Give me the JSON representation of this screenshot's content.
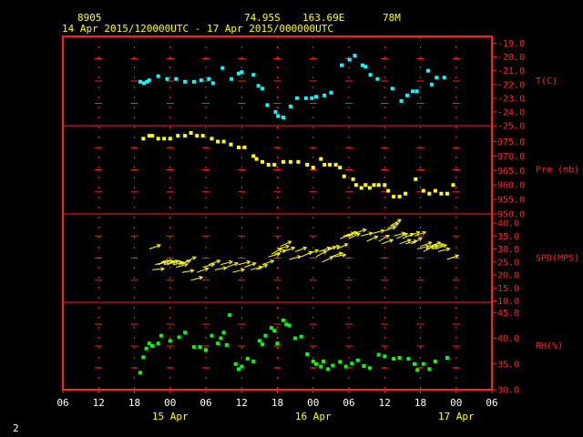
{
  "header": {
    "station_id": "8905",
    "lat": "74.95S",
    "lon": "163.69E",
    "elevation": "78M",
    "period": "14 Apr 2015/120000UTC - 17 Apr 2015/000000UTC"
  },
  "page_number": "2",
  "colors": {
    "frame": "#ff2020",
    "temperature": "#00ffff",
    "pressure": "#ffff00",
    "wind": "#ffff00",
    "humidity": "#00ff00",
    "header_text": "#ffff00",
    "axis_text": "#ffffff"
  },
  "chart_data": {
    "type": "scatter",
    "x_unit": "hours since 14 Apr 2015 06UTC",
    "x_range": [
      0,
      72
    ],
    "x_tick_labels": [
      "06",
      "12",
      "18",
      "00",
      "06",
      "12",
      "18",
      "00",
      "06",
      "12",
      "18",
      "00",
      "06"
    ],
    "date_labels": [
      {
        "x": 18,
        "text": "15 Apr"
      },
      {
        "x": 42,
        "text": "16 Apr"
      },
      {
        "x": 66,
        "text": "17 Apr"
      }
    ],
    "panels": [
      {
        "key": "temperature",
        "label": "T(C)",
        "ylim": [
          -25.0,
          -18.5
        ],
        "ticks": [
          "-19.0",
          "-20.0",
          "-21.0",
          "-22.0",
          "-23.0",
          "-24.0",
          "-25.0"
        ],
        "x": [
          13,
          13.6,
          14.1,
          14.5,
          16,
          17.5,
          19,
          20.5,
          22,
          23.2,
          24.5,
          25.2,
          26.8,
          28.3,
          29.5,
          30,
          32,
          32.8,
          33.5,
          34.3,
          35.7,
          36.1,
          37,
          38.2,
          39.3,
          40.8,
          41.8,
          42.5,
          43.9,
          45,
          46.8,
          48.1,
          49,
          50.3,
          50.8,
          51.6,
          52.8,
          55.3,
          56.8,
          57.8,
          58.7,
          59.4,
          61.3,
          61.9,
          62.7,
          64
        ],
        "values": [
          -21.8,
          -21.9,
          -21.8,
          -21.7,
          -21.4,
          -21.6,
          -21.6,
          -21.8,
          -21.8,
          -21.7,
          -21.6,
          -21.9,
          -20.8,
          -21.6,
          -21.2,
          -21.1,
          -21.3,
          -22.1,
          -22.3,
          -23.5,
          -24.0,
          -24.3,
          -24.4,
          -23.6,
          -23.0,
          -23.0,
          -23.0,
          -22.9,
          -22.8,
          -22.6,
          -20.6,
          -20.2,
          -19.9,
          -20.6,
          -20.7,
          -21.3,
          -21.6,
          -22.3,
          -23.2,
          -22.8,
          -22.5,
          -22.5,
          -21.0,
          -22.0,
          -21.5,
          -21.5
        ]
      },
      {
        "key": "pressure",
        "label": "Pre (mb)",
        "ylim": [
          950.0,
          980.5
        ],
        "ticks": [
          "975.0",
          "970.0",
          "965.0",
          "960.0",
          "955.0",
          "950.0"
        ],
        "x": [
          13.5,
          14.5,
          15,
          16,
          17,
          18,
          19.3,
          20.5,
          21.5,
          22.5,
          23.5,
          25,
          26,
          27,
          28.2,
          29.5,
          30.5,
          32,
          32.5,
          33.5,
          34.5,
          35.5,
          37,
          38.2,
          39.5,
          41,
          42,
          43.3,
          43.9,
          44.8,
          45.8,
          46.5,
          47.2,
          48.7,
          49.2,
          50.1,
          50.8,
          51.5,
          52.2,
          53,
          54,
          54.6,
          55.5,
          56.5,
          57.5,
          59.2,
          60.5,
          61.5,
          62.5,
          63.5,
          64.5,
          65.5
        ],
        "values": [
          976,
          977,
          977,
          976,
          976,
          976,
          977,
          977,
          978,
          977,
          977,
          976,
          975,
          975,
          974,
          973,
          973,
          970,
          969,
          968,
          967,
          967,
          968,
          968,
          968,
          967,
          966,
          969,
          967,
          967,
          967,
          966,
          963,
          962,
          960,
          959,
          960,
          959,
          960,
          960,
          960,
          958,
          956,
          956,
          957,
          962,
          958,
          957,
          958,
          957,
          957,
          960
        ]
      },
      {
        "key": "wind",
        "label": "SPD(MPS)",
        "ylim": [
          9.5,
          43.5
        ],
        "ticks": [
          "40.0",
          "35.0",
          "30.0",
          "25.0",
          "20.0",
          "15.0",
          "10.0"
        ],
        "x": [
          14.5,
          15.0,
          15.5,
          16,
          16.5,
          17,
          17.5,
          18,
          18.5,
          19,
          19.5,
          20,
          20.5,
          21.5,
          22.5,
          23.5,
          24.5,
          25.5,
          26.5,
          27.5,
          28.5,
          29.5,
          30.5,
          31.5,
          32.5,
          33.5,
          34.5,
          35,
          35.5,
          36,
          36.5,
          37,
          38,
          39,
          40,
          41,
          42.5,
          43,
          43.5,
          44,
          44.5,
          45,
          45.5,
          46,
          46.5,
          47,
          47.5,
          48,
          49,
          50,
          51,
          52,
          53,
          53.5,
          54,
          54.5,
          55,
          55.5,
          56,
          56.5,
          57,
          57.5,
          58,
          58.5,
          59,
          59.5,
          60,
          60.5,
          61,
          61.5,
          62,
          62.5,
          63,
          64.5
        ],
        "values": [
          30,
          22,
          24,
          24,
          25,
          24,
          24,
          25,
          24,
          23,
          24,
          21,
          25,
          18,
          21,
          23,
          24,
          22,
          24,
          23,
          21,
          24,
          23,
          22,
          22,
          24,
          27,
          28,
          28,
          30,
          31,
          29,
          26,
          29,
          27,
          28,
          27,
          29,
          25,
          29,
          30,
          27,
          27,
          30,
          34,
          35,
          35,
          34,
          36,
          35,
          33,
          36,
          33,
          32,
          37,
          38,
          39,
          35,
          34,
          32,
          34,
          32,
          35,
          32,
          35,
          30,
          31,
          29,
          30,
          31,
          30,
          30,
          29,
          26
        ],
        "dir_deg": [
          20,
          5,
          15,
          20,
          5,
          15,
          20,
          0,
          10,
          15,
          20,
          10,
          25,
          15,
          20,
          15,
          20,
          10,
          15,
          20,
          15,
          15,
          20,
          15,
          25,
          20,
          15,
          30,
          20,
          15,
          25,
          20,
          15,
          20,
          25,
          20,
          30,
          20,
          25,
          25,
          15,
          20,
          10,
          25,
          20,
          15,
          20,
          25,
          20,
          15,
          25,
          15,
          30,
          20,
          20,
          25,
          30,
          15,
          25,
          20,
          25,
          15,
          20,
          30,
          20,
          15,
          20,
          30,
          20,
          20,
          25,
          20,
          15,
          20
        ]
      },
      {
        "key": "humidity",
        "label": "RH(%)",
        "ylim": [
          30.0,
          47.0
        ],
        "ticks": [
          "45.0",
          "40.0",
          "35.0",
          "30.0"
        ],
        "x": [
          13,
          13.5,
          14,
          14.5,
          15,
          16,
          16.5,
          18,
          19.5,
          20.5,
          22,
          23,
          24,
          25,
          26,
          26.5,
          27,
          27.5,
          28,
          29,
          29.5,
          30,
          31,
          32,
          33,
          33.5,
          34,
          35,
          35.5,
          36,
          37,
          37.5,
          38,
          39,
          40,
          41,
          42,
          42.5,
          43.3,
          43.7,
          44.5,
          45.3,
          46.5,
          47.5,
          48.5,
          49.5,
          50.5,
          51.5,
          53,
          54,
          55.5,
          56.5,
          58,
          59,
          59.5,
          60.5,
          61.5,
          62.5,
          64.5
        ],
        "values": [
          33.3,
          36.3,
          38.0,
          39.0,
          38.5,
          39.0,
          40.5,
          39.5,
          40.2,
          41.1,
          38.3,
          38.3,
          37.7,
          40.5,
          39.0,
          40.0,
          41.1,
          38.7,
          44.5,
          35.0,
          34.0,
          34.5,
          36.0,
          35.5,
          39.5,
          38.8,
          40.5,
          42.0,
          41.5,
          39.0,
          43.5,
          42.7,
          42.5,
          40.0,
          40.3,
          36.9,
          35.5,
          35.0,
          34.5,
          35.5,
          34.0,
          34.7,
          35.4,
          34.5,
          35.1,
          35.7,
          34.6,
          34.2,
          36.8,
          36.5,
          36.0,
          36.2,
          36.0,
          35.0,
          33.8,
          35.0,
          34.0,
          35.5,
          36.2
        ]
      }
    ]
  }
}
